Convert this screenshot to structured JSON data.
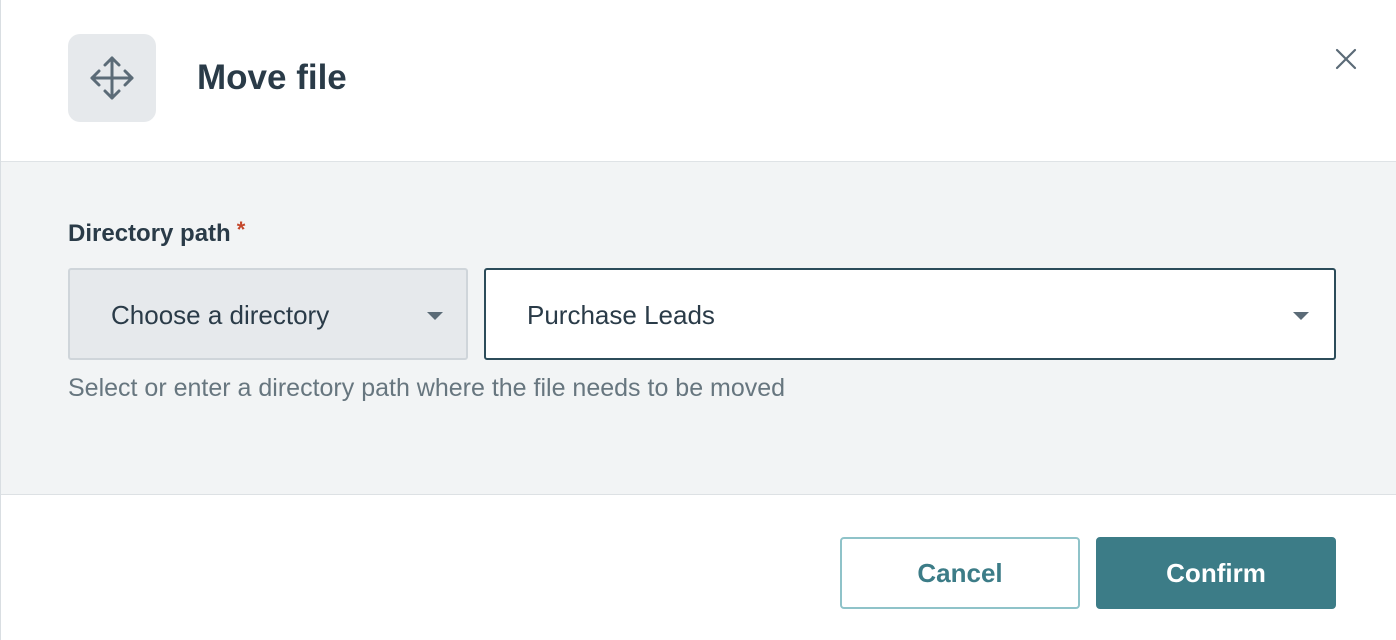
{
  "dialog": {
    "title": "Move file",
    "header_icon": "move-arrows-icon",
    "close_icon": "close-icon"
  },
  "form": {
    "label": "Directory path",
    "required_marker": "*",
    "directory_select": {
      "value": "Choose a directory",
      "icon": "caret-down-icon"
    },
    "path_select": {
      "value": "Purchase Leads",
      "icon": "caret-down-icon"
    },
    "hint": "Select or enter a directory path where the file needs to be moved"
  },
  "footer": {
    "cancel_label": "Cancel",
    "confirm_label": "Confirm"
  },
  "colors": {
    "accent": "#3c7c87",
    "required": "#c4472b",
    "title_text": "#2a3b48",
    "body_background": "#f2f4f5"
  }
}
